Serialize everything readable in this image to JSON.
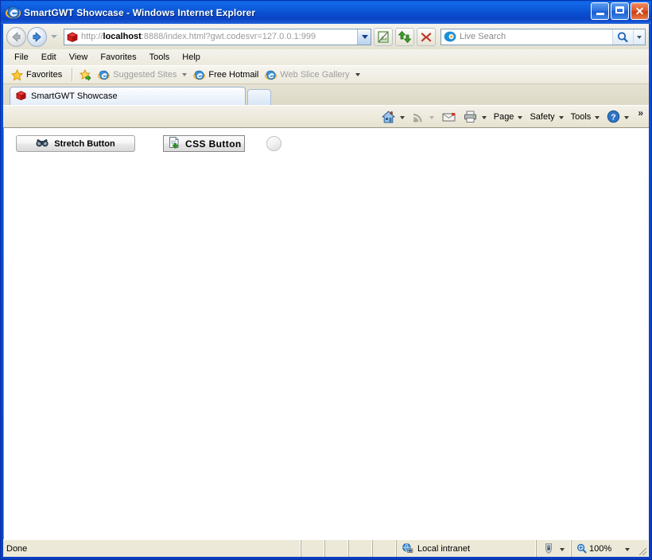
{
  "window": {
    "title": "SmartGWT Showcase - Windows Internet Explorer",
    "app_icon": "internet-explorer-icon",
    "controls": {
      "minimize": "Minimize",
      "maximize": "Maximize",
      "close": "Close"
    }
  },
  "navigation": {
    "back_label": "Back",
    "forward_label": "Forward",
    "history_label": "Recent Pages",
    "address": {
      "favicon": "smartgwt-box-icon",
      "scheme": "http://",
      "host": "localhost",
      "path": ":8888/index.html?gwt.codesvr=127.0.0.1:999",
      "dropdown_label": "Address dropdown"
    },
    "buttons": [
      {
        "name": "compatibility-view-button",
        "icon": "compatibility-view-icon"
      },
      {
        "name": "refresh-button",
        "icon": "refresh-icon"
      },
      {
        "name": "stop-button",
        "icon": "stop-x-icon"
      }
    ],
    "search": {
      "provider_icon": "bing-icon",
      "placeholder": "Live Search",
      "go_label": "Search",
      "dropdown_label": "Search provider options"
    }
  },
  "menubar": {
    "items": [
      {
        "label": "File"
      },
      {
        "label": "Edit"
      },
      {
        "label": "View"
      },
      {
        "label": "Favorites"
      },
      {
        "label": "Tools"
      },
      {
        "label": "Help"
      }
    ]
  },
  "favorites_bar": {
    "favorites_label": "Favorites",
    "items": [
      {
        "label": "Suggested Sites",
        "icon": "internet-explorer-icon",
        "dim": true,
        "caret": true
      },
      {
        "label": "Free Hotmail",
        "icon": "internet-explorer-icon",
        "dim": false,
        "caret": false
      },
      {
        "label": "Web Slice Gallery",
        "icon": "internet-explorer-icon",
        "dim": true,
        "caret": true
      }
    ]
  },
  "tabs": {
    "items": [
      {
        "label": "SmartGWT Showcase",
        "icon": "smartgwt-box-icon",
        "active": true
      }
    ],
    "new_tab_label": "New Tab"
  },
  "command_bar": {
    "items": [
      {
        "label": "",
        "name": "home-button",
        "icon": "home-icon",
        "caret": true,
        "caret_dim": false
      },
      {
        "label": "",
        "name": "feeds-button",
        "icon": "rss-icon",
        "caret": true,
        "caret_dim": true
      },
      {
        "label": "",
        "name": "read-mail-button",
        "icon": "mail-icon",
        "caret": false,
        "caret_dim": false
      },
      {
        "label": "",
        "name": "print-button",
        "icon": "printer-icon",
        "caret": true,
        "caret_dim": false
      },
      {
        "label": "Page",
        "name": "page-menu",
        "icon": "",
        "caret": true,
        "caret_dim": false
      },
      {
        "label": "Safety",
        "name": "safety-menu",
        "icon": "",
        "caret": true,
        "caret_dim": false
      },
      {
        "label": "Tools",
        "name": "tools-menu",
        "icon": "",
        "caret": true,
        "caret_dim": false
      },
      {
        "label": "",
        "name": "help-button",
        "icon": "help-icon",
        "caret": true,
        "caret_dim": false
      }
    ],
    "overflow_label": "»"
  },
  "page": {
    "widgets": [
      {
        "name": "stretch-button",
        "label": "Stretch Button",
        "icon": "binoculars-icon"
      },
      {
        "name": "css-button",
        "label": "CSS Button",
        "icon": "new-document-icon"
      },
      {
        "name": "circle-button",
        "label": "",
        "icon": "circle-icon"
      }
    ]
  },
  "status_bar": {
    "status": "Done",
    "zone": "Local intranet",
    "zone_icon": "globe-network-icon",
    "protected_mode_icon": "protected-mode-icon",
    "zoom_icon": "zoom-magnifier-icon",
    "zoom": "100%"
  }
}
